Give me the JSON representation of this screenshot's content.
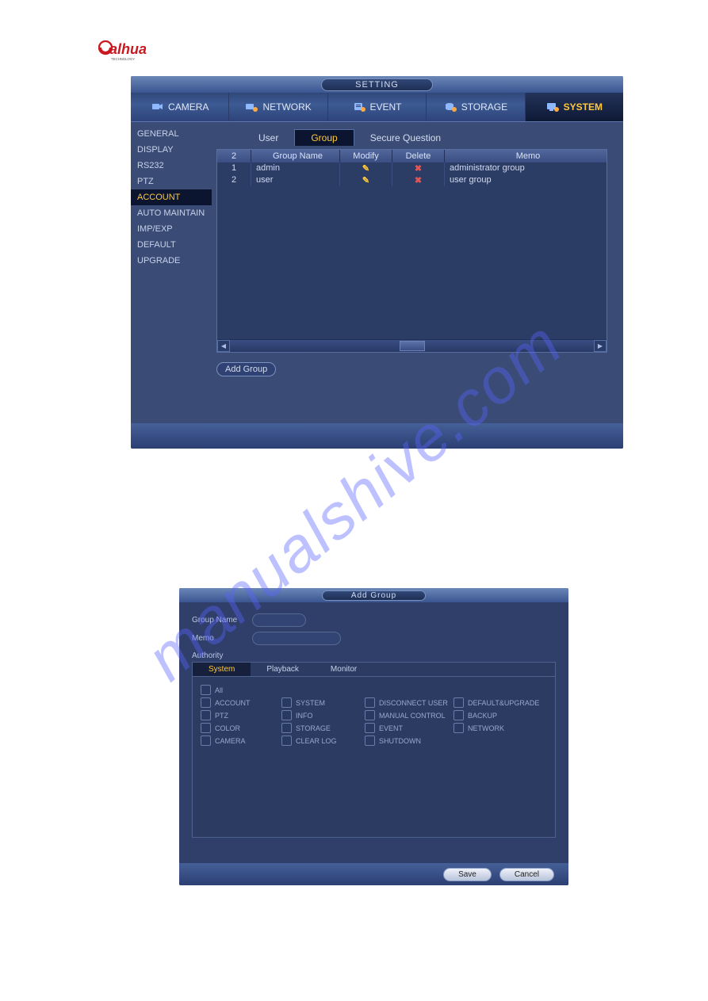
{
  "logo": {
    "brand": "alhua",
    "sub": "TECHNOLOGY"
  },
  "watermark": "manualshive.com",
  "win1": {
    "title": "SETTING",
    "toptabs": [
      {
        "label": "CAMERA"
      },
      {
        "label": "NETWORK"
      },
      {
        "label": "EVENT"
      },
      {
        "label": "STORAGE"
      },
      {
        "label": "SYSTEM"
      }
    ],
    "sidebar": [
      "GENERAL",
      "DISPLAY",
      "RS232",
      "PTZ",
      "ACCOUNT",
      "AUTO MAINTAIN",
      "IMP/EXP",
      "DEFAULT",
      "UPGRADE"
    ],
    "subtabs": [
      "User",
      "Group",
      "Secure Question"
    ],
    "table": {
      "count": "2",
      "headers": {
        "name": "Group Name",
        "modify": "Modify",
        "delete": "Delete",
        "memo": "Memo"
      },
      "rows": [
        {
          "idx": "1",
          "name": "admin",
          "memo": "administrator group"
        },
        {
          "idx": "2",
          "name": "user",
          "memo": "user group"
        }
      ]
    },
    "addgroup": "Add Group"
  },
  "win2": {
    "title": "Add Group",
    "labels": {
      "groupname": "Group Name",
      "memo": "Memo",
      "authority": "Authority"
    },
    "authtabs": [
      "System",
      "Playback",
      "Monitor"
    ],
    "authority": {
      "all": "All",
      "rows": [
        [
          "ACCOUNT",
          "SYSTEM",
          "DISCONNECT USER",
          "DEFAULT&UPGRADE"
        ],
        [
          "PTZ",
          "INFO",
          "MANUAL CONTROL",
          "BACKUP"
        ],
        [
          "COLOR",
          "STORAGE",
          "EVENT",
          "NETWORK"
        ],
        [
          "CAMERA",
          "CLEAR LOG",
          "SHUTDOWN",
          ""
        ]
      ]
    },
    "buttons": {
      "save": "Save",
      "cancel": "Cancel"
    }
  }
}
